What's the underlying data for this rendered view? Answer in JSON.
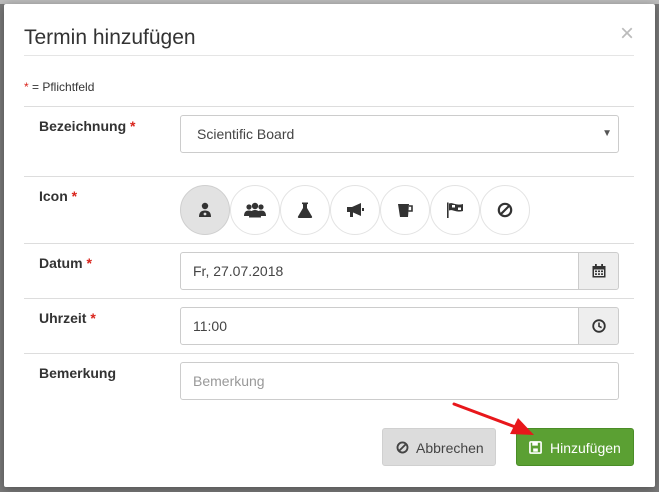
{
  "modal": {
    "title": "Termin hinzufügen",
    "close_symbol": "×",
    "required_marker": "*",
    "required_note": " = Pflichtfeld"
  },
  "fields": {
    "bezeichnung": {
      "label": "Bezeichnung",
      "value": "Scientific Board",
      "options": [
        "Scientific Board"
      ]
    },
    "icon": {
      "label": "Icon",
      "selected": "doctor-icon",
      "options": [
        "doctor-icon",
        "group-icon",
        "flask-icon",
        "megaphone-icon",
        "cup-icon",
        "flag-icon",
        "ban-icon"
      ]
    },
    "datum": {
      "label": "Datum",
      "value": "Fr, 27.07.2018"
    },
    "uhrzeit": {
      "label": "Uhrzeit",
      "value": "11:00"
    },
    "bemerkung": {
      "label": "Bemerkung",
      "placeholder": "Bemerkung",
      "value": ""
    }
  },
  "buttons": {
    "cancel": "Abbrechen",
    "submit": "Hinzufügen"
  },
  "colors": {
    "primary": "#5ba033",
    "required": "#d9241c",
    "annotation_arrow": "#e8171b"
  }
}
